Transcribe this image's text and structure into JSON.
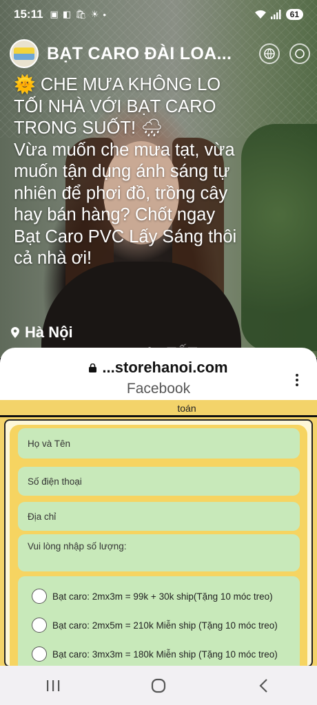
{
  "status_bar": {
    "time": "15:11",
    "battery": "61"
  },
  "header": {
    "page_name": "BẠT CARO ĐÀI LOA..."
  },
  "post": {
    "lines": [
      "CHE MƯA KHÔNG LO",
      "TỐI NHÀ VỚI BẠT CARO",
      "TRONG SUỐT!",
      "Vừa muốn che mưa tạt, vừa",
      "muốn tận dụng ánh sáng tự",
      "nhiên để phơi đồ, trồng cây",
      "hay bán hàng? Chốt ngay",
      "Bạt Caro PVC Lấy Sáng thôi",
      "cả nhà ơi!"
    ],
    "location": "Hà Nội",
    "watermark": "chợTỐT"
  },
  "browser": {
    "url": "...storehanoi.com",
    "subtitle": "Facebook"
  },
  "form": {
    "top_label": "toán",
    "name_placeholder": "Họ và Tên",
    "phone_placeholder": "Số điện thoại",
    "address_placeholder": "Địa chỉ",
    "quantity_placeholder": "Vui lòng nhập số lượng:",
    "options": [
      "Bạt caro: 2mx3m = 99k + 30k ship(Tặng 10 móc treo)",
      "Bạt caro: 2mx5m = 210k Miễn ship (Tặng 10 móc treo)",
      "Bạt caro: 3mx3m = 180k Miễn ship (Tặng 10 móc treo)"
    ]
  }
}
